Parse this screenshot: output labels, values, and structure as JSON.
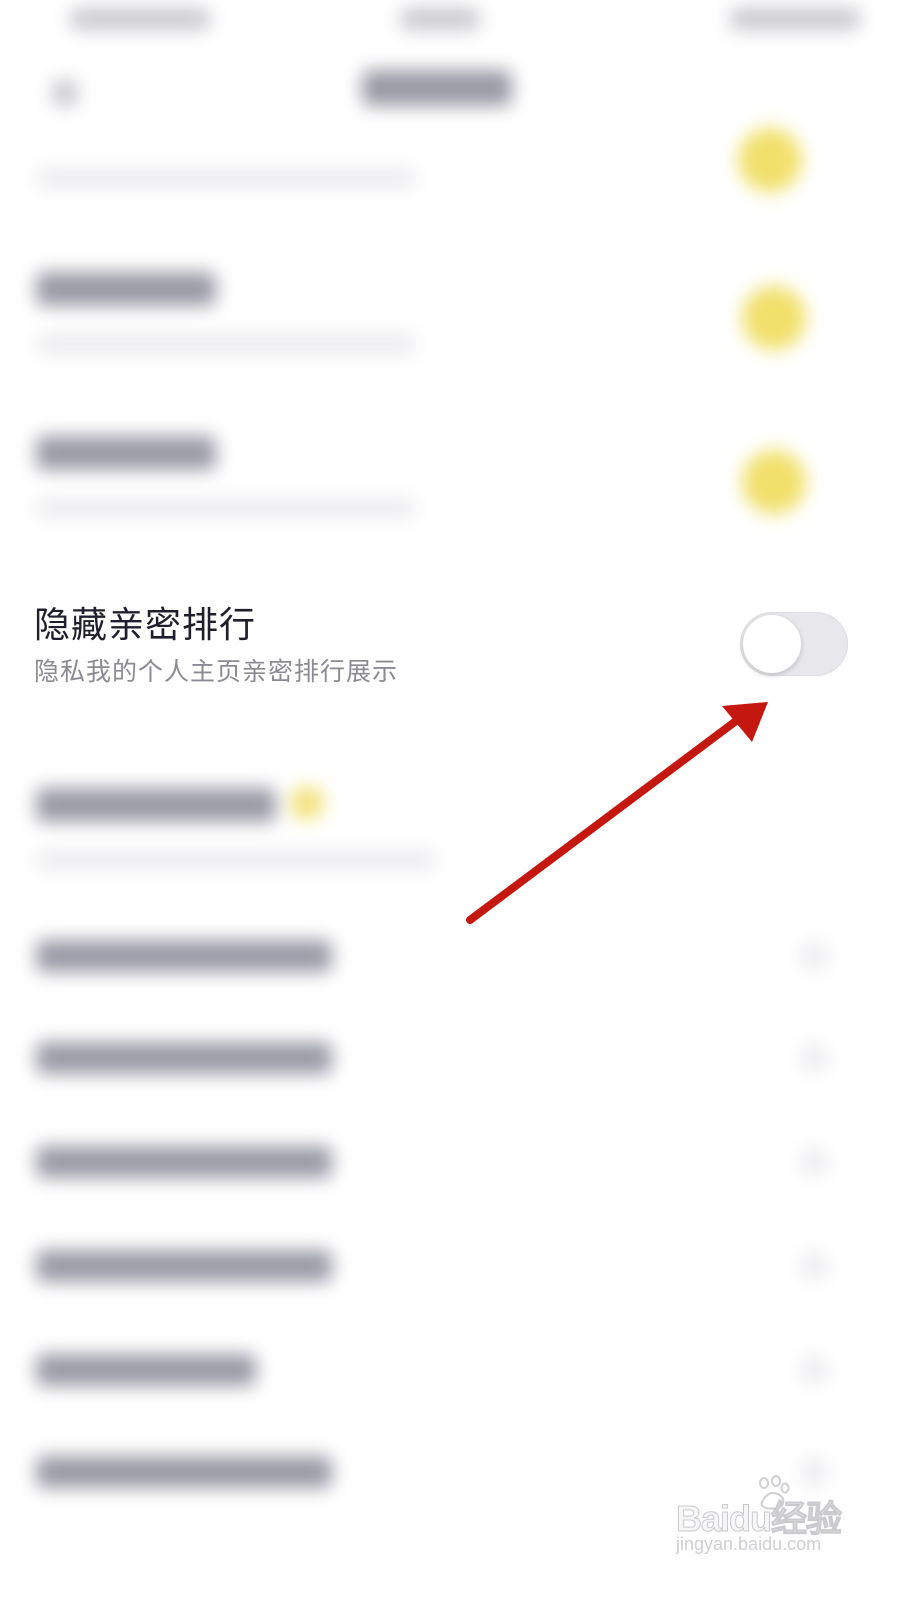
{
  "setting": {
    "title": "隐藏亲密排行",
    "subtitle": "隐私我的个人主页亲密排行展示",
    "toggle_state": "off"
  },
  "annotation": {
    "arrow_color": "#c4170f"
  },
  "watermark": {
    "brand": "Baidu经验",
    "url": "jingyan.baidu.com"
  },
  "colors": {
    "background": "#ffffff",
    "toggle_track": "#e8e8ec",
    "accent_yellow": "#f1e06a"
  }
}
